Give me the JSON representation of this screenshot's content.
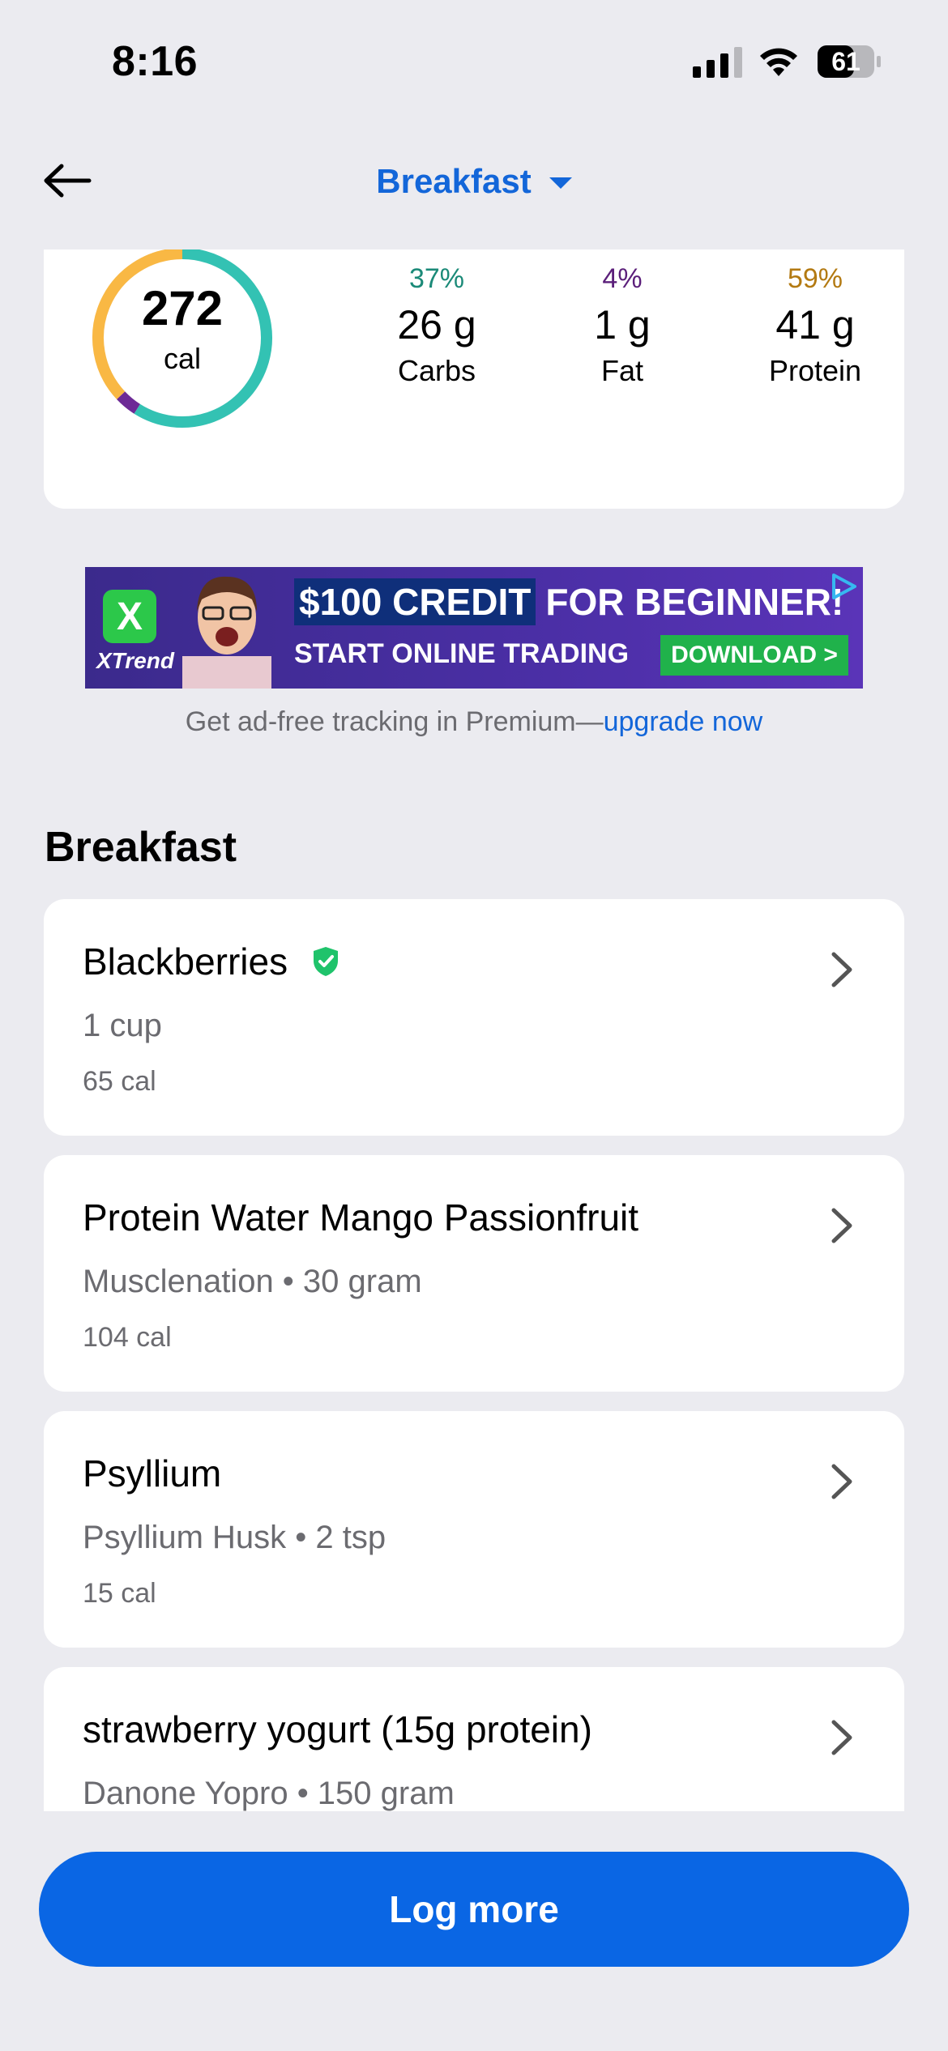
{
  "status_bar": {
    "time": "8:16",
    "battery": "61"
  },
  "nav": {
    "title": "Breakfast"
  },
  "summary": {
    "calories": "272",
    "calories_unit": "cal",
    "macros": [
      {
        "pct": "37%",
        "amount": "26 g",
        "label": "Carbs",
        "color": "#1B8A78"
      },
      {
        "pct": "4%",
        "amount": "1 g",
        "label": "Fat",
        "color": "#5B1F7A"
      },
      {
        "pct": "59%",
        "amount": "41 g",
        "label": "Protein",
        "color": "#B37A12"
      }
    ],
    "ring_colors": {
      "carbs": "#F9B844",
      "fat": "#6D2A96",
      "protein": "#33C2B3"
    }
  },
  "ad": {
    "brand": "XTrend",
    "headline_highlight": "$100 CREDIT",
    "headline_rest": "FOR BEGINNER!",
    "subline": "START ONLINE TRADING",
    "cta": "DOWNLOAD >",
    "note_text": "Get ad-free tracking in Premium—",
    "note_link": "upgrade now"
  },
  "section": {
    "title": "Breakfast"
  },
  "foods": [
    {
      "name": "Blackberries",
      "verified": true,
      "detail": "1 cup",
      "calories": "65 cal"
    },
    {
      "name": "Protein Water Mango Passionfruit",
      "verified": false,
      "detail": "Musclenation • 30 gram",
      "calories": "104 cal"
    },
    {
      "name": "Psyllium",
      "verified": false,
      "detail": "Psyllium Husk • 2 tsp",
      "calories": "15 cal"
    },
    {
      "name": "strawberry yogurt (15g protein)",
      "verified": false,
      "detail": "Danone Yopro • 150 gram",
      "calories": ""
    }
  ],
  "footer": {
    "button_label": "Log more"
  }
}
